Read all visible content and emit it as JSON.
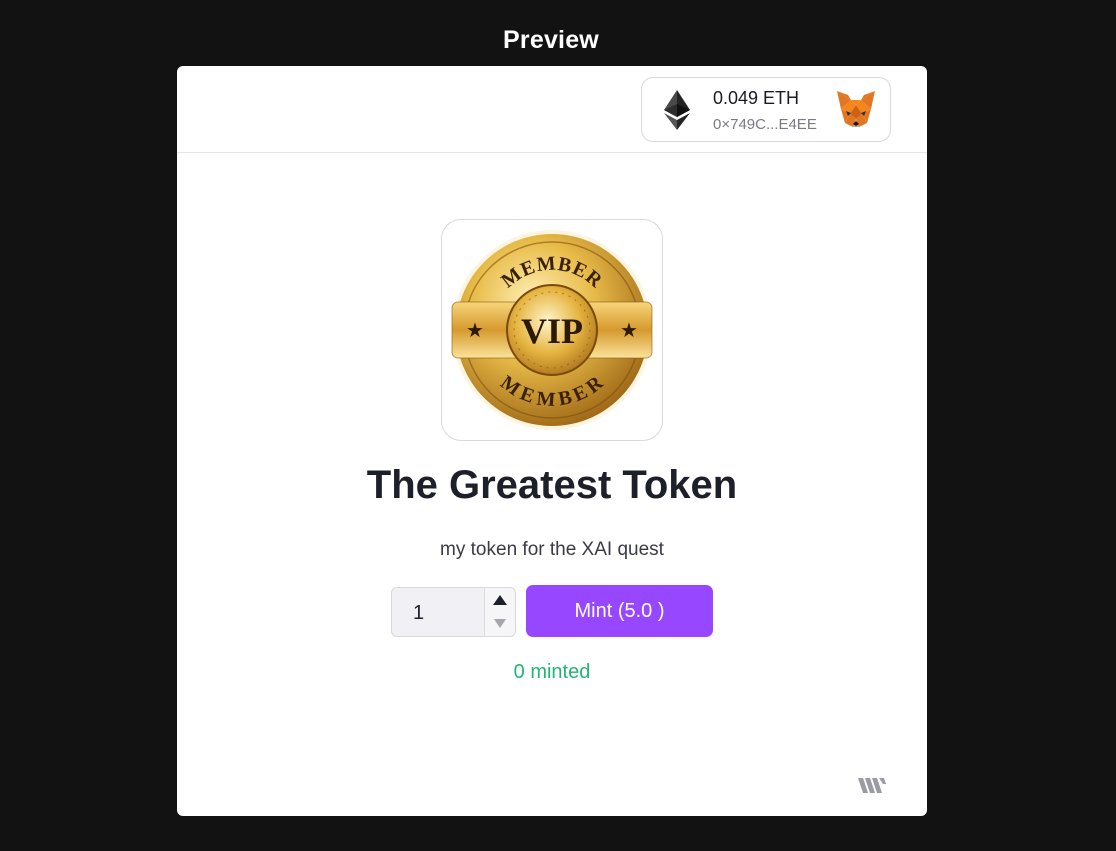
{
  "page": {
    "title": "Preview"
  },
  "wallet": {
    "balance": "0.049 ETH",
    "address": "0×749C...E4EE",
    "network_icon": "ethereum-icon",
    "wallet_icon": "metamask-fox-icon"
  },
  "token": {
    "image_icon": "vip-member-badge",
    "image_text": {
      "top": "MEMBER",
      "center": "VIP",
      "bottom": "MEMBER"
    },
    "title": "The Greatest Token",
    "description": "my token for the XAI quest"
  },
  "mint": {
    "quantity": "1",
    "button_label": "Mint (5.0 )",
    "minted_status": "0 minted"
  },
  "footer": {
    "brand_icon": "brand-logo-icon"
  },
  "colors": {
    "page_background": "#121212",
    "card_background": "#ffffff",
    "accent": "#9747ff",
    "success": "#22b573",
    "text_primary": "#1e2029"
  }
}
